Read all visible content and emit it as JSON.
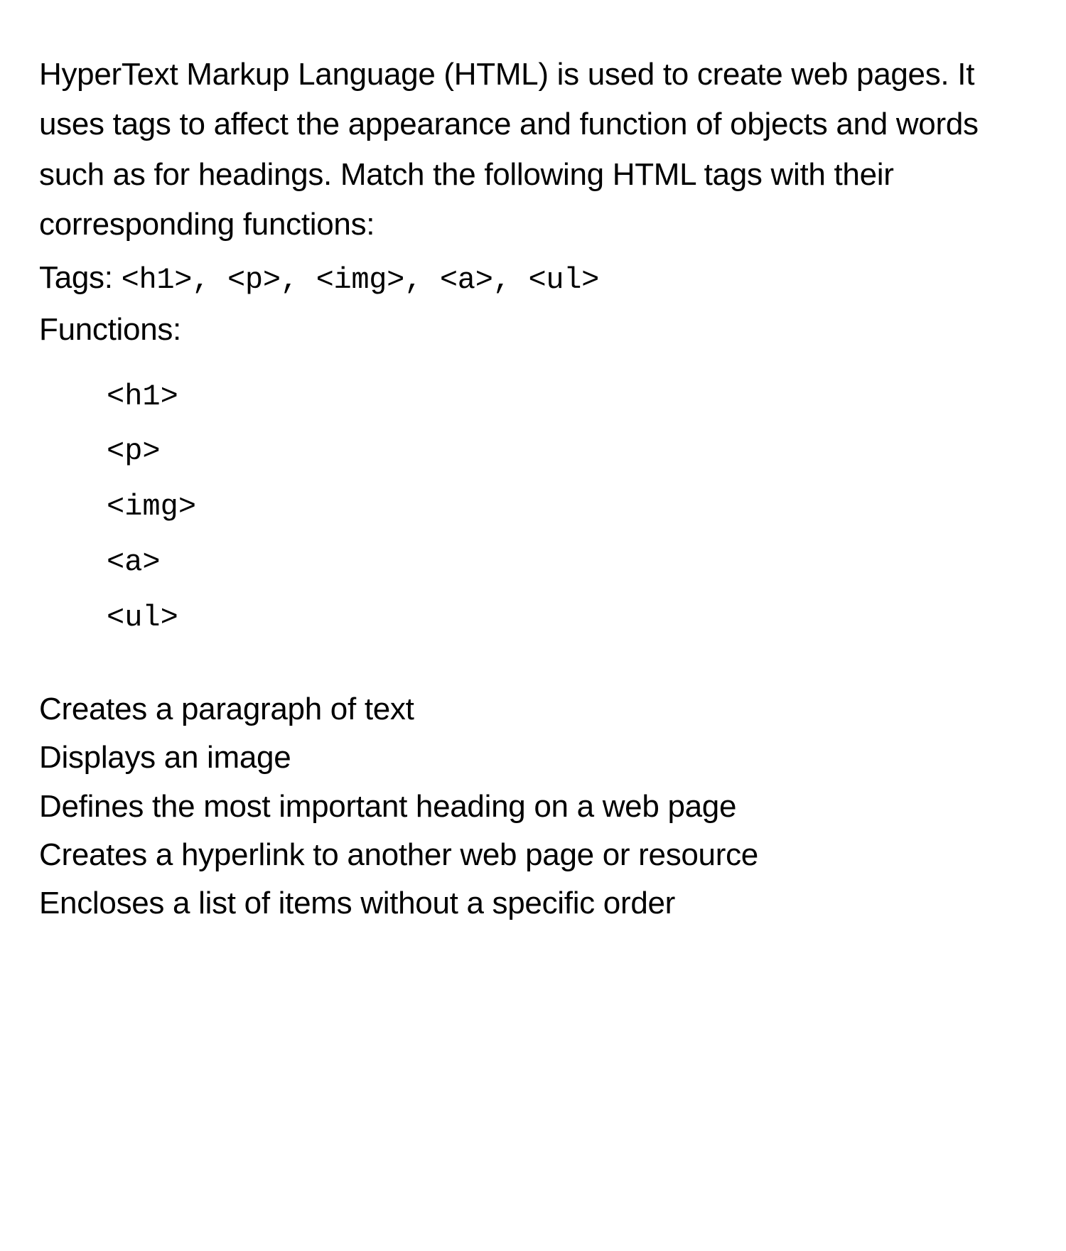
{
  "content": {
    "intro": "HyperText Markup Language (HTML) is used to create web pages. It uses tags to affect the appearance and function of objects and words such as for headings. Match the following HTML tags with their corresponding functions:",
    "tagsLabel": "Tags: ",
    "tagsInline": {
      "t1": "<h1>",
      "c1": ", ",
      "t2": "<p>",
      "c2": ", ",
      "t3": "<img>",
      "c3": ", ",
      "t4": "<a>",
      "c4": ", ",
      "t5": "<ul>"
    },
    "functionsLabel": "Functions:",
    "tagList": [
      "<h1>",
      "<p>",
      "<img>",
      "<a>",
      "<ul>"
    ],
    "functionDescriptions": [
      "Creates a paragraph of text",
      "Displays an image",
      "Defines the most important heading on a web page",
      "Creates a hyperlink to another web page or resource",
      "Encloses a list of items without a specific order"
    ]
  }
}
